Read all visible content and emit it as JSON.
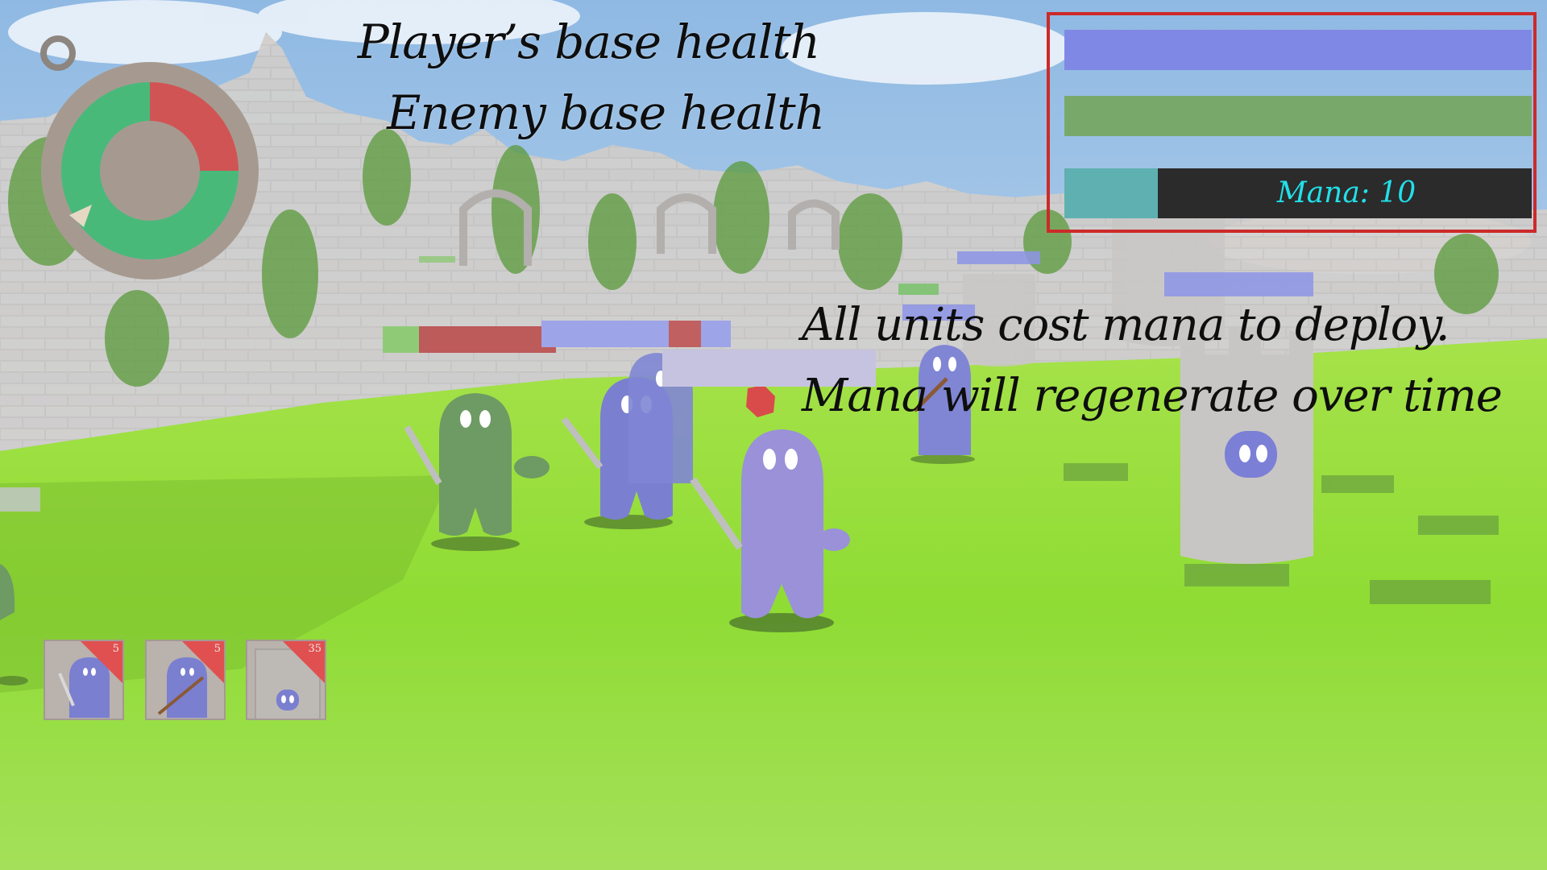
{
  "hud": {
    "player_base_label": "Player’s base health",
    "enemy_base_label": "Enemy base health",
    "player_base_health_fraction": 1.0,
    "enemy_base_health_fraction": 1.0,
    "mana_fill_fraction": 0.2,
    "mana_label": "Mana: 10",
    "panel_border_color": "#cc2a2a",
    "player_color": "#8088e6",
    "enemy_color": "#79a96a",
    "mana_text_color": "#22e0ea"
  },
  "tutorial": {
    "line1": "All units cost mana to deploy.",
    "line2": "Mana will regenerate over time"
  },
  "timer": {
    "icon": "stopwatch-icon",
    "player_share_fraction": 0.75,
    "enemy_share_fraction": 0.25
  },
  "unit_cards": [
    {
      "name": "swordsman-card",
      "icon": "swordsman-icon",
      "cost": "5"
    },
    {
      "name": "archer-card",
      "icon": "archer-icon",
      "cost": "5"
    },
    {
      "name": "tower-card",
      "icon": "tower-icon",
      "cost": "35"
    }
  ]
}
